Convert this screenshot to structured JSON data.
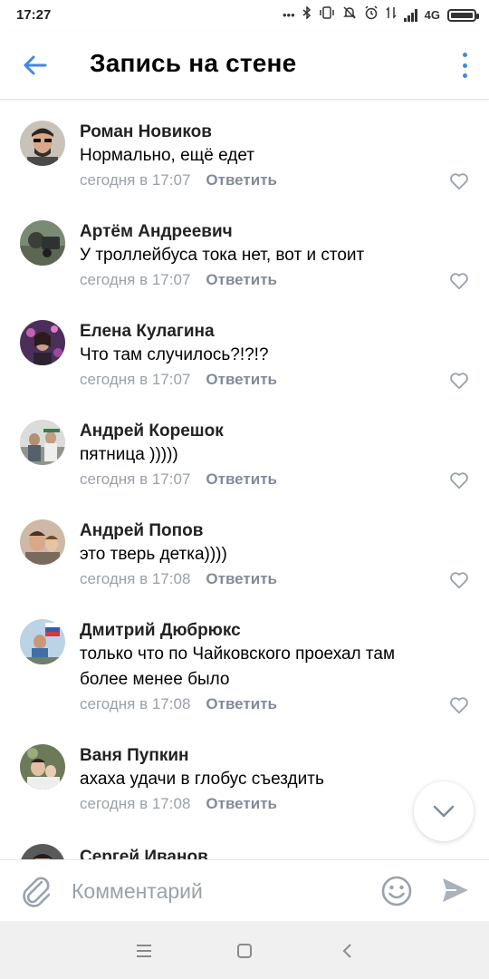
{
  "status_bar": {
    "time": "17:27",
    "network": "4G",
    "icons": [
      "dots-icon",
      "bluetooth-icon",
      "vibrate-icon",
      "mute-icon",
      "alarm-icon",
      "data-arrows-icon",
      "signal-icon",
      "battery-icon"
    ]
  },
  "header": {
    "title": "Запись на стене",
    "back_icon": "arrow-left-icon",
    "more_icon": "more-vertical-icon"
  },
  "colors": {
    "accent": "#3f8ae0",
    "meta_text": "#9aa1a8",
    "reply_text": "#828a99",
    "divider": "#e7e8ec"
  },
  "reply_label": "Ответить",
  "comments": [
    {
      "author": "Роман Новиков",
      "lines": [
        "Нормально, ещё едет"
      ],
      "time": "сегодня в 17:07",
      "reply": "Ответить"
    },
    {
      "author": "Артём Андреевич",
      "lines": [
        "У троллейбуса тока нет, вот и стоит"
      ],
      "time": "сегодня в 17:07",
      "reply": "Ответить"
    },
    {
      "author": "Елена Кулагина",
      "lines": [
        "Что там случилось?!?!?"
      ],
      "time": "сегодня в 17:07",
      "reply": "Ответить"
    },
    {
      "author": "Андрей Корешок",
      "lines": [
        "пятница )))))"
      ],
      "time": "сегодня в 17:07",
      "reply": "Ответить"
    },
    {
      "author": "Андрей Попов",
      "lines": [
        "это тверь детка))))"
      ],
      "time": "сегодня в 17:08",
      "reply": "Ответить"
    },
    {
      "author": "Дмитрий Дюбрюкс",
      "lines": [
        "только что по Чайковского проехал там",
        "более менее было"
      ],
      "time": "сегодня в 17:08",
      "reply": "Ответить"
    },
    {
      "author": "Ваня Пупкин",
      "lines": [
        "ахаха удачи в глобус съездить"
      ],
      "time": "сегодня в 17:08",
      "reply": "Ответить"
    },
    {
      "author": "Сергей Иванов",
      "lines": [],
      "time": "",
      "reply": ""
    }
  ],
  "composer": {
    "placeholder": "Комментарий",
    "value": "",
    "attach_icon": "paperclip-icon",
    "emoji_icon": "smiley-icon",
    "send_icon": "send-icon"
  },
  "scroll_down_icon": "chevron-down-icon",
  "nav_bar": {
    "icons": [
      "menu-icon",
      "home-square-icon",
      "back-chevron-icon"
    ]
  }
}
